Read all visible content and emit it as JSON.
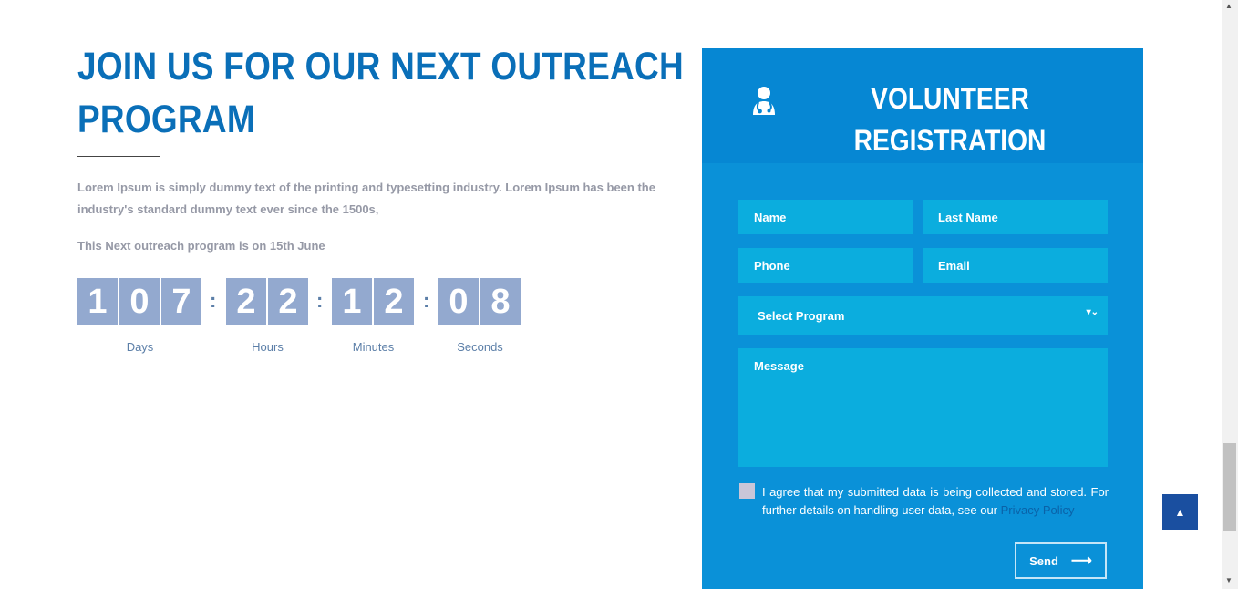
{
  "outreach": {
    "title": "JOIN US FOR OUR NEXT OUTREACH PROGRAM",
    "description": "Lorem Ipsum is simply dummy text of the printing and typesetting industry. Lorem Ipsum has been the industry's standard dummy text ever since the 1500s,",
    "date_text": "This Next outreach program is on 15th June"
  },
  "countdown": {
    "separator": ":",
    "days": {
      "digits": [
        "1",
        "0",
        "7"
      ],
      "label": "Days"
    },
    "hours": {
      "digits": [
        "2",
        "2"
      ],
      "label": "Hours"
    },
    "minutes": {
      "digits": [
        "1",
        "2"
      ],
      "label": "Minutes"
    },
    "seconds": {
      "digits": [
        "0",
        "8"
      ],
      "label": "Seconds"
    }
  },
  "form": {
    "title_line1": "VOLUNTEER",
    "title_line2": "REGISTRATION",
    "icon": "doctor-icon",
    "name_placeholder": "Name",
    "last_name_placeholder": "Last Name",
    "phone_placeholder": "Phone",
    "email_placeholder": "Email",
    "program_select": "Select Program",
    "message_placeholder": "Message",
    "consent_text": "I agree that my submitted data is being collected and stored. For further details on handling user data, see our ",
    "privacy_link": "Privacy Policy",
    "send_label": "Send",
    "send_icon": "arrow-right-icon"
  },
  "colors": {
    "title": "#0a6fb8",
    "panel": "#0a91d8",
    "field": "#0badde",
    "digit_box": "#93a9cf",
    "top_button": "#1a4fa0"
  }
}
